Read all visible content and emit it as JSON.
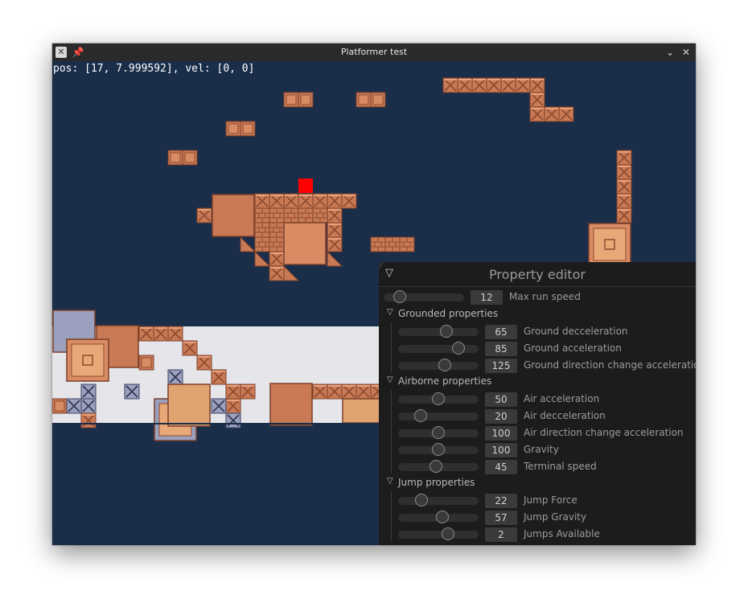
{
  "window": {
    "title": "Platformer test",
    "icons": [
      "app-icon",
      "pin-icon",
      "minimize-icon",
      "close-icon"
    ]
  },
  "hud": {
    "text": "pos: [17, 7.999592], vel: [0, 0]"
  },
  "colors": {
    "background": "#1a2e4a",
    "brick": "#c97a55",
    "player": "#ff0000",
    "stone": "#e6e6ea",
    "steel": "#9aa0bd",
    "panel": "#1c1c1c"
  },
  "editor": {
    "title": "Property editor",
    "top_property": {
      "label": "Max run speed",
      "value": "12",
      "fraction": 0.14
    },
    "groups": [
      {
        "name": "Grounded properties",
        "items": [
          {
            "label": "Ground decceleration",
            "value": "65",
            "fraction": 0.62
          },
          {
            "label": "Ground acceleration",
            "value": "85",
            "fraction": 0.8
          },
          {
            "label": "Ground direction change acceleration",
            "value": "125",
            "fraction": 0.6
          }
        ]
      },
      {
        "name": "Airborne properties",
        "items": [
          {
            "label": "Air acceleration",
            "value": "50",
            "fraction": 0.5
          },
          {
            "label": "Air decceleration",
            "value": "20",
            "fraction": 0.24
          },
          {
            "label": "Air direction change acceleration",
            "value": "100",
            "fraction": 0.5
          },
          {
            "label": "Gravity",
            "value": "100",
            "fraction": 0.5
          },
          {
            "label": "Terminal speed",
            "value": "45",
            "fraction": 0.46
          }
        ]
      },
      {
        "name": "Jump properties",
        "items": [
          {
            "label": "Jump Force",
            "value": "22",
            "fraction": 0.25
          },
          {
            "label": "Jump Gravity",
            "value": "57",
            "fraction": 0.56
          },
          {
            "label": "Jumps Available",
            "value": "2",
            "fraction": 0.64
          }
        ]
      }
    ]
  }
}
